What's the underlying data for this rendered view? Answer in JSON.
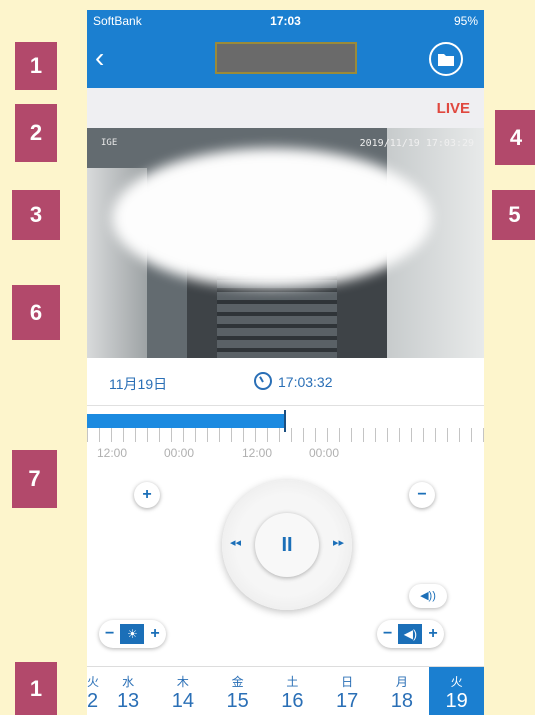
{
  "badges": {
    "b1a": "1",
    "b2": "2",
    "b3": "3",
    "b4": "4",
    "b5": "5",
    "b6": "6",
    "b7": "7",
    "b1b": "1"
  },
  "status": {
    "carrier": "SoftBank",
    "time": "17:03",
    "battery": "95%"
  },
  "live": "LIVE",
  "video": {
    "osd_left": "IGE",
    "timestamp": "2019/11/19 17:03:29"
  },
  "datebar": {
    "date": "11月19日",
    "time": "17:03:32"
  },
  "timeline": {
    "labels": [
      "12:00",
      "00:00",
      "12:00",
      "00:00"
    ],
    "progress_fraction": 0.5
  },
  "controls": {
    "plus": "+",
    "minus": "−",
    "pause": "II",
    "rewind": "◂◂",
    "forward": "▸▸",
    "speaker": "◀))",
    "brightness_icon": "☀",
    "volume_icon": "◀)"
  },
  "week": [
    {
      "dow": "火",
      "num": "2"
    },
    {
      "dow": "水",
      "num": "13"
    },
    {
      "dow": "木",
      "num": "14"
    },
    {
      "dow": "金",
      "num": "15"
    },
    {
      "dow": "土",
      "num": "16"
    },
    {
      "dow": "日",
      "num": "17"
    },
    {
      "dow": "月",
      "num": "18"
    },
    {
      "dow": "火",
      "num": "19"
    }
  ]
}
